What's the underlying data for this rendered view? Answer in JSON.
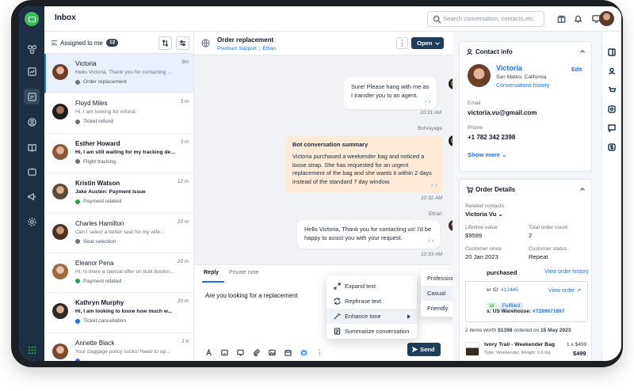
{
  "topbar": {
    "title": "Inbox",
    "search_placeholder": "Search conversation, contacts,etc."
  },
  "list": {
    "filter_label": "Assigned to me",
    "count": "12",
    "conversations": [
      {
        "name": "Victoria",
        "time": "3m",
        "preview": "Hello Victoria, Thank you for contacting ...",
        "tag": "Order replacement",
        "tag_color": "#6b7280",
        "active": true,
        "bold": false
      },
      {
        "name": "Floyd Miles",
        "time": "3 m",
        "preview": "Hi, I am looking for refund.",
        "tag": "Ticket refund",
        "tag_color": "#6b7280",
        "active": false,
        "bold": false
      },
      {
        "name": "Esther Howard",
        "time": "3 m",
        "preview": "Hi, I am still waiting for my tracking details",
        "tag": "Flight tracking",
        "tag_color": "#6b7280",
        "active": false,
        "bold": true
      },
      {
        "name": "Kristin Watson",
        "time": "12 m",
        "preview": "Jake Austen: Payment issue",
        "tag": "Payment related",
        "tag_color": "#22a04b",
        "active": false,
        "bold": true
      },
      {
        "name": "Charles Hamilton",
        "time": "20 m",
        "preview": "Can I select a better seat for my wife...",
        "tag": "Seat selection",
        "tag_color": "#6b7280",
        "active": false,
        "bold": false
      },
      {
        "name": "Eleanor Pena",
        "time": "20 m",
        "preview": "Hi, Is there a special offer on bulk booking...",
        "tag": "Payment related",
        "tag_color": "#22a04b",
        "active": false,
        "bold": false
      },
      {
        "name": "Kathryn Murphy",
        "time": "20 m",
        "preview": "Hi, I am looking to know how much w...",
        "tag": "Ticket cancellation",
        "tag_color": "#1f6feb",
        "active": false,
        "bold": true
      },
      {
        "name": "Annette Black",
        "time": "1 h",
        "preview": "Your baggage policy sucks! Need to up...",
        "tag": "",
        "tag_color": "#1f6feb",
        "active": false,
        "bold": false
      }
    ]
  },
  "chat": {
    "title": "Order replacement",
    "subtitle_team": "Premium Support",
    "subtitle_sep": "|",
    "subtitle_agent": "Ethan",
    "more": "⋮",
    "status_button": "Open",
    "messages": {
      "m1_text": "Sure! Please hang with me as I transfer you to an agent.",
      "m1_time": "10:31 AM",
      "bot_sender": "BotVoyage",
      "bot_title": "Bot conversation summary",
      "bot_text": "Victoria purchased a weekender bag and noticed a loose strap. She has requested for an urgent replacement of the bag and she wants it within 2 days instead of the standard 7 day window.",
      "bot_time": "10:32 AM",
      "agent_sender": "Ethan",
      "m3_text": "Hello Victoria, Thank you for contacting us! I'd be happy to assist you with your request.",
      "m3_time": "10:33 AM"
    },
    "composer": {
      "tab_reply": "Reply",
      "tab_note": "Private note",
      "draft": "Are you looking for a replacement w",
      "send": "Send"
    }
  },
  "ai_menu": {
    "items": [
      "Expand text",
      "Rephrase text",
      "Enhance tone",
      "Summarize conversation"
    ],
    "tones": [
      "Professional",
      "Casual",
      "Friendly"
    ]
  },
  "contact": {
    "header": "Contact info",
    "name": "Victoria",
    "location": "San Mateo, California",
    "history_link": "Conversations history",
    "edit": "Edit",
    "email_label": "Email",
    "email": "victoria.vu@gmail.com",
    "phone_label": "Phone",
    "phone": "+1 782 342 2398",
    "show_more": "Show more"
  },
  "order": {
    "header": "Order Details",
    "related_label": "Related contacts",
    "related": "Victoria Vu",
    "lifetime_label": "Lifetime value",
    "lifetime": "$9599",
    "total_label": "Total order count",
    "total": "2",
    "since_label": "Customer since",
    "since": "20 Jan 2023",
    "status_label": "Customer status",
    "status": "Repeat",
    "purchased_title": "purchased",
    "view_history": "View order history",
    "order_id_label": "er ID:",
    "order_id": "#12445",
    "view_order": "View order",
    "chip_paid": "id",
    "chip_fulfilled": "Fulfilled",
    "warehouse_label": "s: US Warehouse:",
    "warehouse_id": "#7299671897",
    "summary_pre": "2 items",
    "summary_mid": "worth",
    "summary_amount": "$1398",
    "summary_post": "ordered on",
    "summary_date": "15 May 2023",
    "item_name": "Ivory Trail - Weekender Bag",
    "item_meta": "Type: Weekender, Weight: 0.6 Kg",
    "item_qty": "1 x $499",
    "item_total": "$499"
  },
  "colors": {
    "accent": "#1f6feb",
    "navy": "#1d3f5b",
    "rail": "#1d2f40",
    "bot_bubble": "#fdebd8"
  }
}
